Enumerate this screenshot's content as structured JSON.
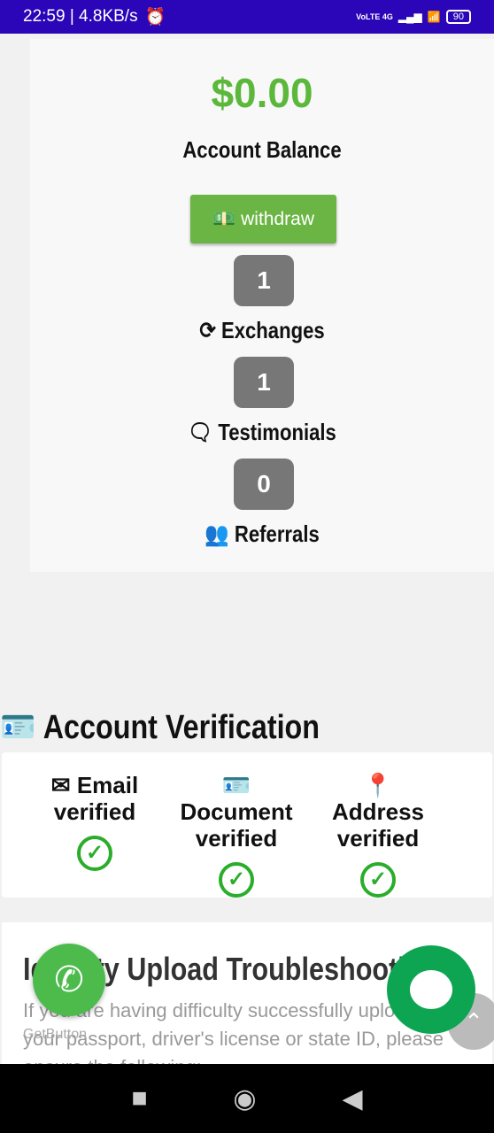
{
  "status_bar": {
    "time": "22:59 | 4.8KB/s",
    "battery": "90",
    "signal": "VoLTE 4G"
  },
  "balance": {
    "amount": "$0.00",
    "label": "Account Balance",
    "withdraw_label": "withdraw"
  },
  "stats": [
    {
      "count": "1",
      "label": "Exchanges",
      "icon": "sync-icon"
    },
    {
      "count": "1",
      "label": "Testimonials",
      "icon": "comments-icon"
    },
    {
      "count": "0",
      "label": "Referrals",
      "icon": "users-icon"
    }
  ],
  "verification": {
    "title": "Account Verification",
    "items": [
      {
        "name": "Email",
        "status": "verified"
      },
      {
        "name": "Document",
        "status": "verified"
      },
      {
        "name": "Address",
        "status": "verified"
      }
    ]
  },
  "troubleshooting": {
    "title": "Identity Upload Troubleshooting",
    "text": "If you are having difficulty successfully uploading your passport, driver's license or state ID, please ensure the following:"
  },
  "widgets": {
    "getbutton": "GetButton"
  },
  "colors": {
    "accent": "#5bb83b",
    "status_bar": "#2a06b8",
    "check": "#2aad2a"
  }
}
